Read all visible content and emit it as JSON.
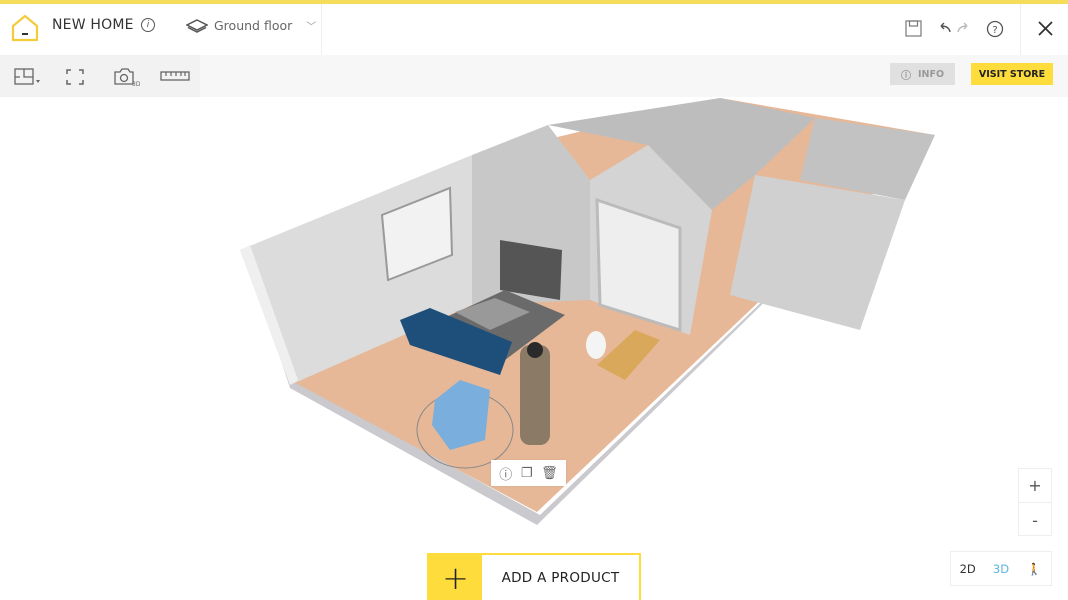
{
  "header": {
    "project_title": "NEW HOME",
    "floor_selector": "Ground floor",
    "icons": [
      "home-logo",
      "info-icon",
      "layers-icon",
      "save-icon",
      "undo-icon",
      "redo-icon",
      "help-icon",
      "close-icon"
    ]
  },
  "toolbar": {
    "tools": [
      "floorplan-icon",
      "fullscreen-icon",
      "camera-3d-icon",
      "ruler-icon"
    ],
    "camera_badge": "3D",
    "info_label": "INFO",
    "store_label": "VISIT STORE"
  },
  "colors": {
    "accent": "#fddc3c",
    "active_view": "#5bb5e0",
    "floor": "#e8b896",
    "wall": "#d8d8d8"
  },
  "context_menu": [
    "info-icon",
    "duplicate-icon",
    "trash-icon"
  ],
  "zoom": {
    "in": "+",
    "out": "-"
  },
  "views": {
    "v2d": "2D",
    "v3d": "3D",
    "active": "3D"
  },
  "add_product": {
    "plus": "+",
    "label": "ADD A PRODUCT"
  }
}
